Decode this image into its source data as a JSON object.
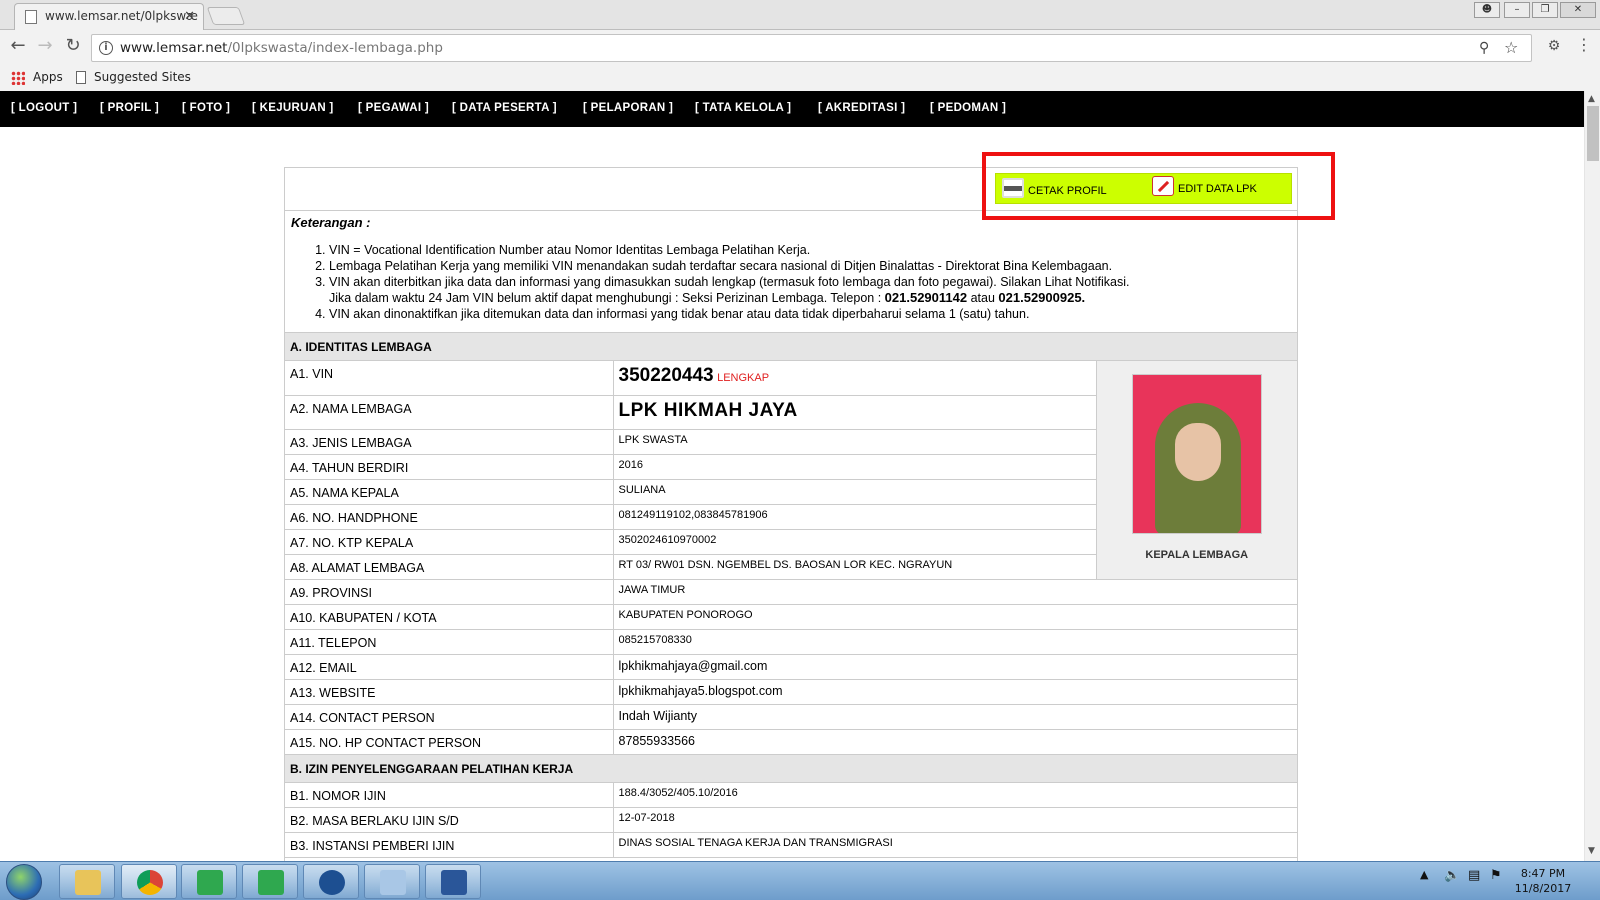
{
  "browser": {
    "tab_title": "www.lemsar.net/0lpkswæ",
    "tab_close": "✕",
    "url_host": "www.lemsar.net",
    "url_path": "/0lpkswasta/index-lembaga.php",
    "bookmarks": {
      "apps": "Apps",
      "suggested": "Suggested Sites"
    }
  },
  "menu": [
    "[ LOGOUT ]",
    "[ PROFIL ]",
    "[ FOTO ]",
    "[ KEJURUAN ]",
    "[ PEGAWAI ]",
    "[ DATA PESERTA ]",
    "[ PELAPORAN ]",
    "[ TATA KELOLA ]",
    "[ AKREDITASI ]",
    "[ PEDOMAN ]"
  ],
  "actions": {
    "print": "CETAK PROFIL",
    "edit": "EDIT DATA LPK"
  },
  "keterangan": {
    "title": "Keterangan :",
    "note1": "VIN = Vocational Identification Number atau Nomor Identitas Lembaga Pelatihan Kerja.",
    "note2": "Lembaga Pelatihan Kerja yang memiliki VIN menandakan sudah terdaftar secara nasional di Ditjen Binalattas - Direktorat Bina Kelembagaan.",
    "note3a": "VIN akan diterbitkan jika data dan informasi yang dimasukkan sudah lengkap (termasuk foto lembaga dan foto pegawai). Silakan Lihat Notifikasi.",
    "note3b": "Jika dalam waktu 24 Jam VIN belum aktif dapat menghubungi : Seksi Perizinan Lembaga. Telepon :",
    "phone1": "021.52901142",
    "atau": "atau",
    "phone2": "021.52900925.",
    "note4": "VIN akan dinonaktifkan jika ditemukan data dan informasi yang tidak benar atau data tidak diperbaharui selama 1 (satu) tahun."
  },
  "section_a": {
    "title": "A. IDENTITAS LEMBAGA",
    "photo_caption": "KEPALA LEMBAGA",
    "vin_label": "A1. VIN",
    "vin": "350220443",
    "vin_status": "LENGKAP",
    "nama_label": "A2. NAMA LEMBAGA",
    "nama": "LPK HIKMAH JAYA",
    "rows": [
      {
        "label": "A3. JENIS LEMBAGA",
        "value": "LPK SWASTA"
      },
      {
        "label": "A4. TAHUN BERDIRI",
        "value": "2016"
      },
      {
        "label": "A5. NAMA KEPALA",
        "value": "SULIANA"
      },
      {
        "label": "A6. NO. HANDPHONE",
        "value": "081249119102,083845781906"
      },
      {
        "label": "A7. NO. KTP KEPALA",
        "value": "3502024610970002"
      },
      {
        "label": "A8. ALAMAT LEMBAGA",
        "value": "RT 03/ RW01 DSN. NGEMBEL DS. BAOSAN LOR KEC. NGRAYUN"
      },
      {
        "label": "A9. PROVINSI",
        "value": "JAWA TIMUR"
      },
      {
        "label": "A10. KABUPATEN / KOTA",
        "value": "KABUPATEN PONOROGO"
      },
      {
        "label": "A11. TELEPON",
        "value": "085215708330"
      },
      {
        "label": "A12. EMAIL",
        "value": "lpkhikmahjaya@gmail.com"
      },
      {
        "label": "A13. WEBSITE",
        "value": "lpkhikmahjaya5.blogspot.com"
      },
      {
        "label": "A14. CONTACT PERSON",
        "value": "Indah Wijianty"
      },
      {
        "label": "A15. NO. HP CONTACT PERSON",
        "value": "87855933566"
      }
    ]
  },
  "section_b": {
    "title": "B. IZIN PENYELENGGARAAN PELATIHAN KERJA",
    "rows": [
      {
        "label": "B1. NOMOR IJIN",
        "value": "188.4/3052/405.10/2016"
      },
      {
        "label": "B2. MASA BERLAKU IJIN S/D",
        "value": "12-07-2018"
      },
      {
        "label": "B3. INSTANSI PEMBERI IJIN",
        "value": "DINAS SOSIAL TENAGA KERJA DAN TRANSMIGRASI"
      }
    ]
  },
  "taskbar": {
    "time": "8:47 PM",
    "date": "11/8/2017"
  },
  "colors": {
    "menu_bg": "#000000",
    "action_bg": "#ccff00",
    "highlight": "#ee1111",
    "status_red": "#e02020"
  }
}
